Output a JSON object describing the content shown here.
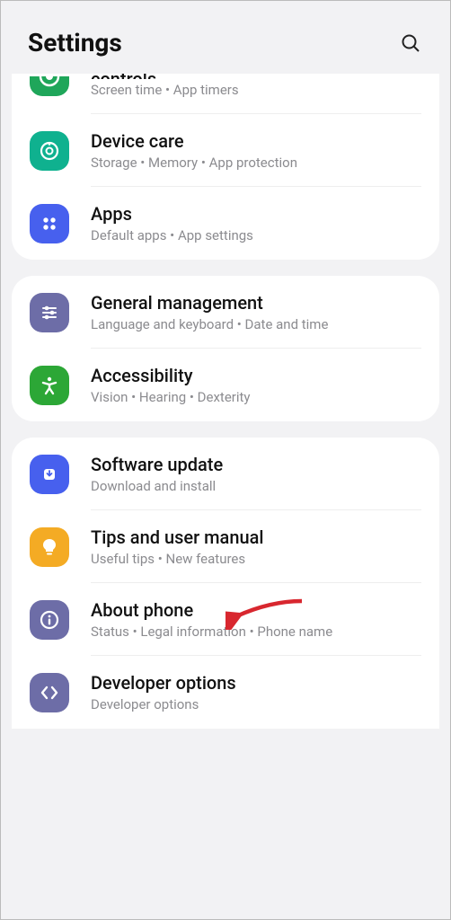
{
  "header": {
    "title": "Settings"
  },
  "groups": [
    {
      "partialTop": true,
      "items": [
        {
          "title": "controls",
          "subtitle": "Screen time  •  App timers",
          "iconColor": "#1fa65a",
          "iconName": "wellbeing-icon",
          "cut": true
        },
        {
          "title": "Device care",
          "subtitle": "Storage  •  Memory  •  App protection",
          "iconColor": "#0fb18f",
          "iconName": "device-care-icon"
        },
        {
          "title": "Apps",
          "subtitle": "Default apps  •  App settings",
          "iconColor": "#4760ee",
          "iconName": "apps-icon"
        }
      ]
    },
    {
      "items": [
        {
          "title": "General management",
          "subtitle": "Language and keyboard  •  Date and time",
          "iconColor": "#6d6da7",
          "iconName": "general-management-icon"
        },
        {
          "title": "Accessibility",
          "subtitle": "Vision  •  Hearing  •  Dexterity",
          "iconColor": "#2ca736",
          "iconName": "accessibility-icon"
        }
      ]
    },
    {
      "partialBottom": true,
      "items": [
        {
          "title": "Software update",
          "subtitle": "Download and install",
          "iconColor": "#4760ee",
          "iconName": "software-update-icon"
        },
        {
          "title": "Tips and user manual",
          "subtitle": "Useful tips  •  New features",
          "iconColor": "#f4ab24",
          "iconName": "tips-icon"
        },
        {
          "title": "About phone",
          "subtitle": "Status  •  Legal information  •  Phone name",
          "iconColor": "#6d6da7",
          "iconName": "about-phone-icon",
          "arrow": true
        },
        {
          "title": "Developer options",
          "subtitle": "Developer options",
          "iconColor": "#6d6da7",
          "iconName": "developer-options-icon"
        }
      ]
    }
  ]
}
